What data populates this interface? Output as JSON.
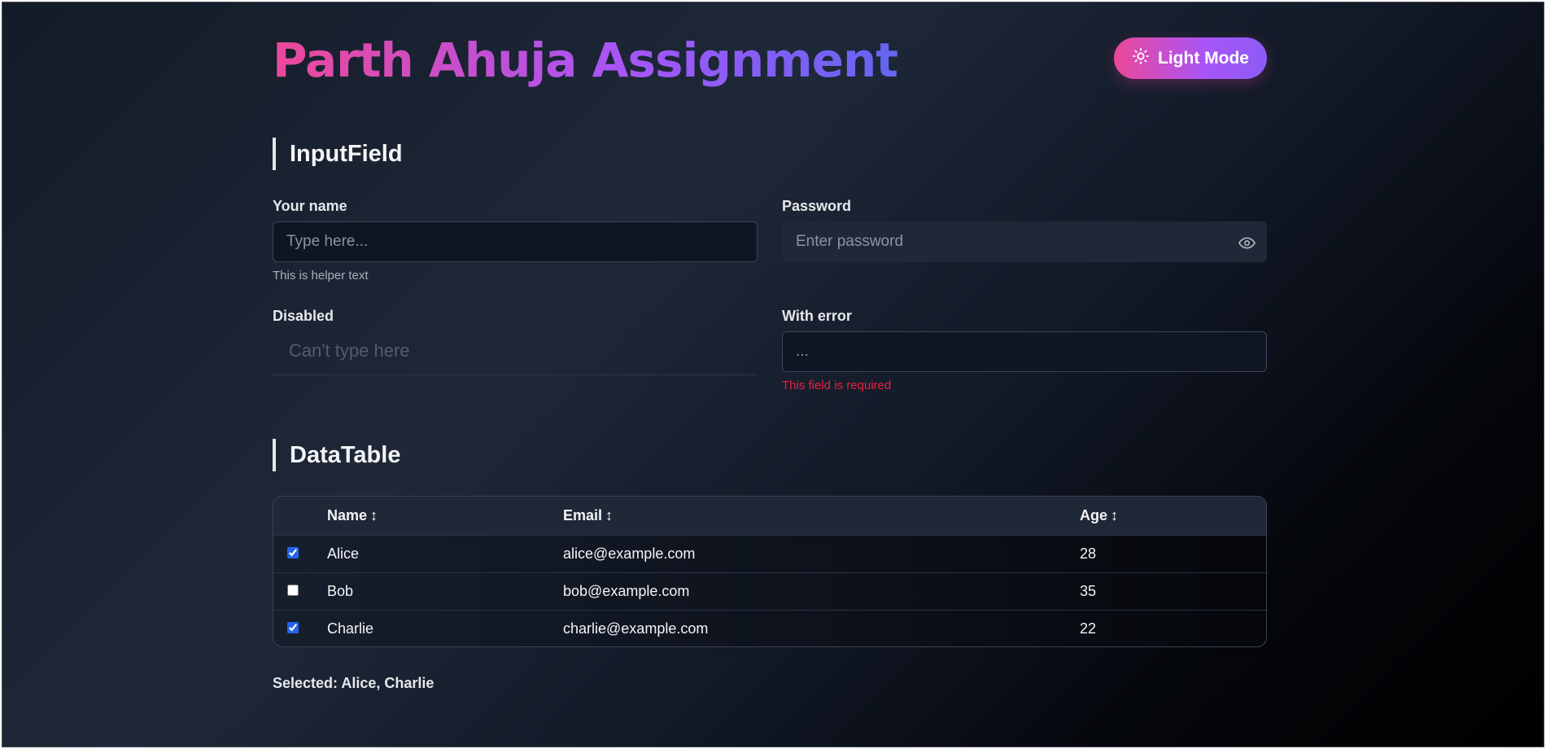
{
  "header": {
    "title": "Parth Ahuja Assignment",
    "theme_toggle_label": "Light Mode"
  },
  "input_section": {
    "title": "InputField",
    "name_field": {
      "label": "Your name",
      "placeholder": "Type here...",
      "value": "",
      "helper": "This is helper text"
    },
    "password_field": {
      "label": "Password",
      "placeholder": "Enter password",
      "value": ""
    },
    "disabled_field": {
      "label": "Disabled",
      "placeholder": "Can't type here",
      "value": ""
    },
    "error_field": {
      "label": "With error",
      "placeholder": "...",
      "value": "",
      "error": "This field is required"
    }
  },
  "table_section": {
    "title": "DataTable",
    "columns": [
      "Name",
      "Email",
      "Age"
    ],
    "sort_indicator": "↕",
    "rows": [
      {
        "name": "Alice",
        "email": "alice@example.com",
        "age": "28",
        "checked": true
      },
      {
        "name": "Bob",
        "email": "bob@example.com",
        "age": "35",
        "checked": false
      },
      {
        "name": "Charlie",
        "email": "charlie@example.com",
        "age": "22",
        "checked": true
      }
    ],
    "selected_text": "Selected: Alice, Charlie"
  },
  "colors": {
    "title_gradient_start": "#ec4899",
    "title_gradient_end": "#6366f1",
    "error": "#ef1e3c",
    "checkbox_accent": "#2563eb"
  },
  "icons": {
    "theme_toggle": "sun-icon",
    "password_toggle": "eye-icon"
  }
}
